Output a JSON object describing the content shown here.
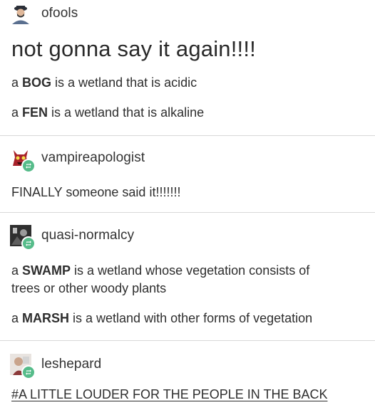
{
  "post1": {
    "username": "ofools",
    "headline": "not gonna say it again!!!!",
    "line1": {
      "pre": "a ",
      "bold": "BOG",
      "post": " is a wetland that is acidic"
    },
    "line2": {
      "pre": "a ",
      "bold": "FEN",
      "post": " is a wetland that is alkaline"
    }
  },
  "post2": {
    "username": "vampireapologist",
    "text": "FINALLY someone said it!!!!!!!"
  },
  "post3": {
    "username": "quasi-normalcy",
    "line1a": {
      "pre": "a ",
      "bold": "SWAMP",
      "post": " is a wetland whose vegetation consists of"
    },
    "line1b": "trees or other woody plants",
    "line2": {
      "pre": "a ",
      "bold": "MARSH",
      "post": " is a wetland with other forms of vegetation"
    }
  },
  "post4": {
    "username": "leshepard",
    "tag": "#A LITTLE LOUDER FOR THE PEOPLE IN THE BACK"
  },
  "colors": {
    "reblog_badge": "#56bc8a",
    "divider": "#d8d8d8"
  }
}
